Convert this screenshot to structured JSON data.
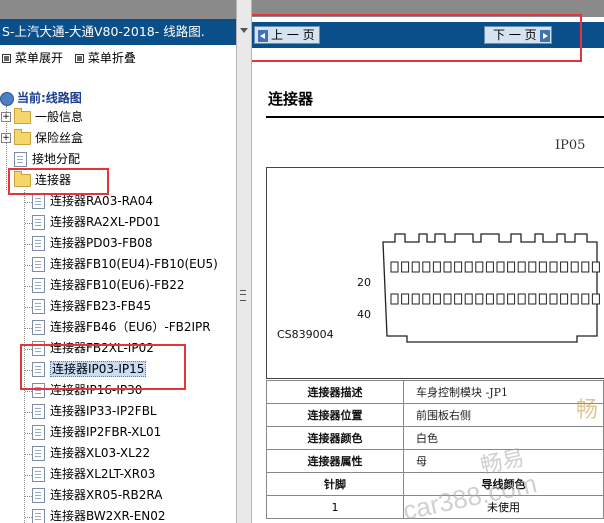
{
  "left_panel": {
    "title": "S-上汽大通-大通V80-2018- 线路图.",
    "menu": {
      "expand": "菜单展开",
      "collapse": "菜单折叠"
    },
    "tree": {
      "current": "当前:线路图",
      "folders": [
        "一般信息",
        "保险丝盒"
      ],
      "doc_ground": "接地分配",
      "folder_open": "连接器",
      "items": [
        "连接器RA03-RA04",
        "连接器RA2XL-PD01",
        "连接器PD03-FB08",
        "连接器FB10(EU4)-FB10(EU5)",
        "连接器FB10(EU6)-FB22",
        "连接器FB23-FB45",
        "连接器FB46（EU6）-FB2IPR",
        "连接器FB2XL-IP02",
        "连接器IP03-IP15",
        "连接器IP16-IP30",
        "连接器IP33-IP2FBL",
        "连接器IP2FBR-XL01",
        "连接器XL03-XL22",
        "连接器XL2LT-XR03",
        "连接器XR05-RB2RA",
        "连接器BW2XR-EN02"
      ],
      "selected_index": 8
    }
  },
  "nav": {
    "prev": "上 一 页",
    "next": "下 一 页"
  },
  "doc": {
    "heading": "连接器",
    "connector_id": "IP05",
    "part_number": "CS839004",
    "pin_labels": [
      "20",
      "40"
    ],
    "table": [
      {
        "key": "连接器描述",
        "value": "车身控制模块 -JP1"
      },
      {
        "key": "连接器位置",
        "value": "前围板右侧"
      },
      {
        "key": "连接器颜色",
        "value": "白色"
      },
      {
        "key": "连接器属性",
        "value": "母"
      }
    ],
    "pin_header": {
      "pin": "针脚",
      "func": "导线颜色"
    },
    "pin_rows": [
      {
        "pin": "1",
        "func": "未使用"
      }
    ]
  },
  "watermarks": [
    "畅易",
    "畅",
    "car388.com"
  ],
  "colors": {
    "title_bar": "#0b4f8a",
    "highlight": "#e4363a"
  }
}
